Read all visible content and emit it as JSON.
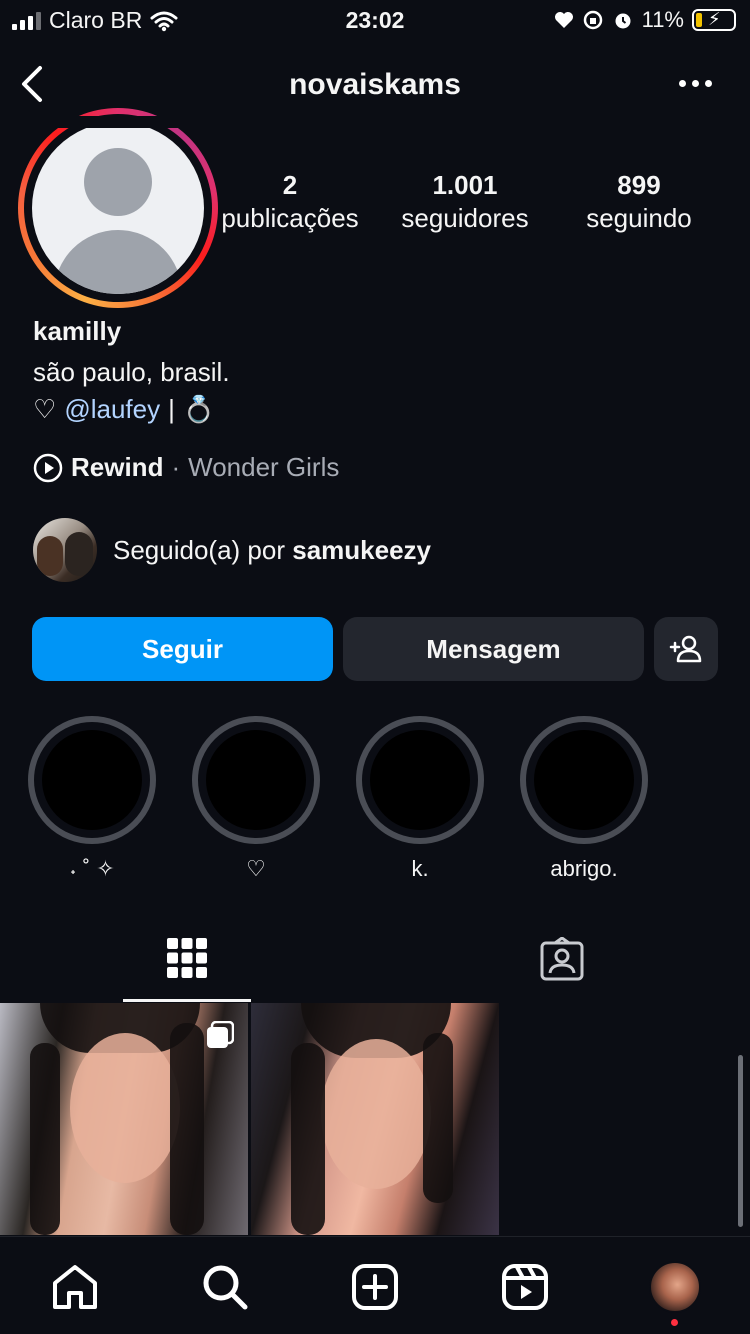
{
  "status_bar": {
    "carrier": "Claro BR",
    "time": "23:02",
    "battery": "11%"
  },
  "header": {
    "username": "novaiskams"
  },
  "stats": [
    {
      "value": "2",
      "label": "publicações"
    },
    {
      "value": "1.001",
      "label": "seguidores"
    },
    {
      "value": "899",
      "label": "seguindo"
    }
  ],
  "bio": {
    "name": "kamilly",
    "location": "são paulo, brasil.",
    "heart": "♡",
    "mention": "@laufey",
    "separator": "|",
    "ring": "💍"
  },
  "music": {
    "track": "Rewind",
    "separator": "·",
    "artist": "Wonder Girls"
  },
  "followed_by": {
    "prefix": "Seguido(a) por",
    "user": "samukeezy"
  },
  "buttons": {
    "follow": "Seguir",
    "message": "Mensagem"
  },
  "highlights": [
    {
      "label": "˖ ˚ ✧"
    },
    {
      "label": "♡"
    },
    {
      "label": "k."
    },
    {
      "label": "abrigo."
    }
  ],
  "tabs": {
    "active": "posts-grid"
  },
  "colors": {
    "background": "#0b0d14",
    "primary_button": "#0095f6",
    "secondary_button": "#23262e",
    "mention": "#b3d4ff",
    "notification_dot": "#ff3040"
  },
  "icons": {
    "back": "chevron-left-icon",
    "more": "more-horizontal-icon",
    "add_person": "add-person-icon",
    "grid": "grid-icon",
    "tagged": "tagged-icon",
    "home": "home-icon",
    "search": "search-icon",
    "create": "plus-square-icon",
    "reels": "reels-icon"
  }
}
